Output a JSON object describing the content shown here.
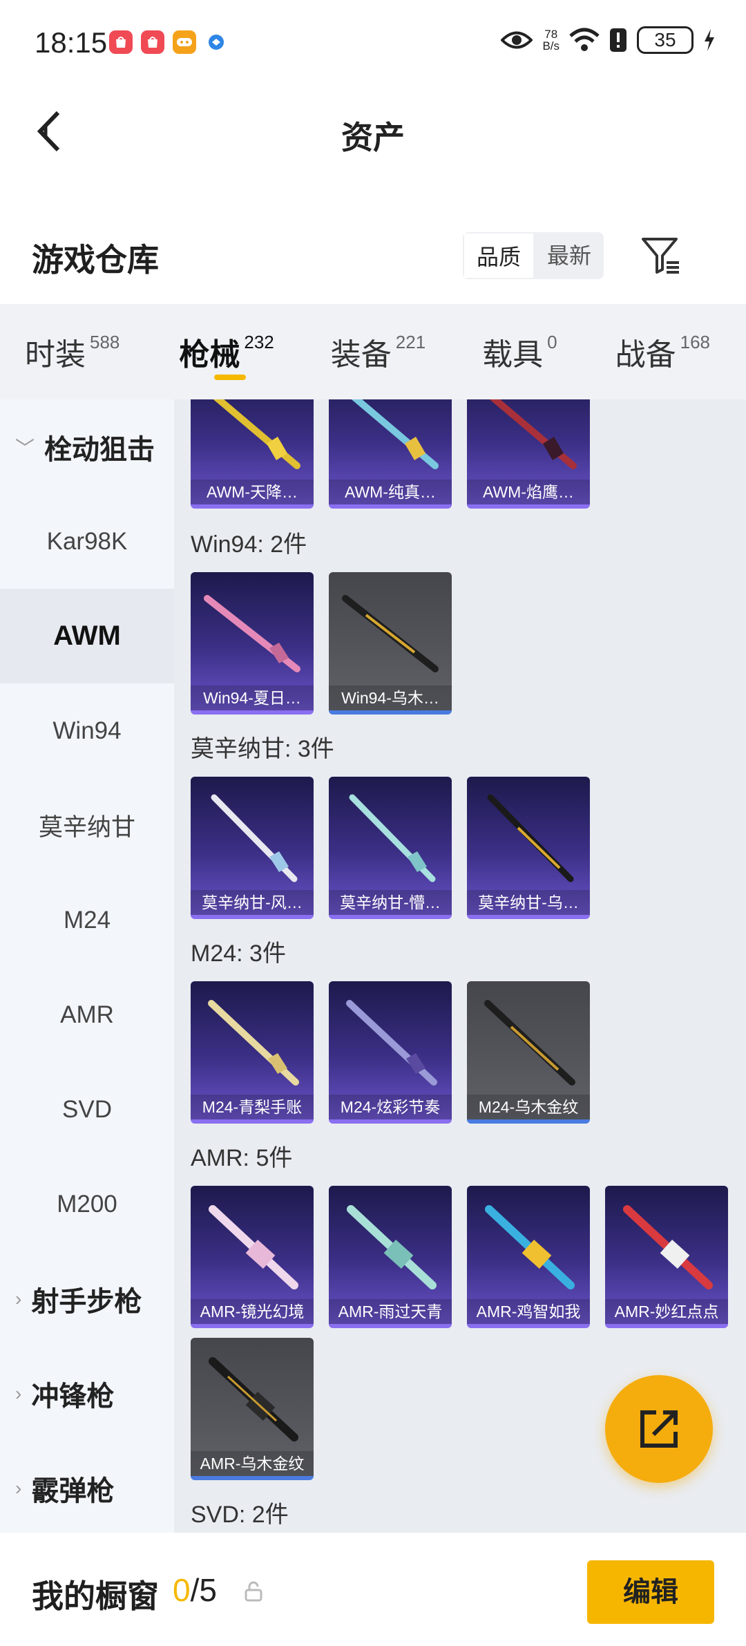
{
  "status_bar": {
    "time": "18:15",
    "net_speed_value": "78",
    "net_speed_unit": "B/s",
    "battery": "35",
    "icons": [
      "eye-icon",
      "wifi-icon",
      "alert-icon",
      "battery-icon",
      "charging-icon"
    ]
  },
  "nav": {
    "title": "资产",
    "back_icon": "chevron-left-icon"
  },
  "warehouse": {
    "title": "游戏仓库",
    "sort_options": [
      "品质",
      "最新"
    ],
    "sort_selected": "品质",
    "filter_icon": "filter-icon"
  },
  "tabs": [
    {
      "label": "时装",
      "count": "588"
    },
    {
      "label": "枪械",
      "count": "232",
      "active": true
    },
    {
      "label": "装备",
      "count": "221"
    },
    {
      "label": "载具",
      "count": "0"
    },
    {
      "label": "战备",
      "count": "168"
    }
  ],
  "sidenav": [
    {
      "label": "栓动狙击",
      "type": "group-expanded"
    },
    {
      "label": "Kar98K"
    },
    {
      "label": "AWM",
      "active": true
    },
    {
      "label": "Win94"
    },
    {
      "label": "莫辛纳甘"
    },
    {
      "label": "M24"
    },
    {
      "label": "AMR"
    },
    {
      "label": "SVD"
    },
    {
      "label": "M200"
    },
    {
      "label": "射手步枪",
      "type": "group-collapsed"
    },
    {
      "label": "冲锋枪",
      "type": "group-collapsed"
    },
    {
      "label": "霰弹枪",
      "type": "group-collapsed"
    }
  ],
  "content": {
    "awm_items": [
      "AWM-天降…",
      "AWM-纯真…",
      "AWM-焰鹰…"
    ],
    "groups": [
      {
        "label": "Win94: 2件",
        "items": [
          "Win94-夏日…",
          "Win94-乌木…"
        ]
      },
      {
        "label": "莫辛纳甘: 3件",
        "items": [
          "莫辛纳甘-风…",
          "莫辛纳甘-懵…",
          "莫辛纳甘-乌…"
        ]
      },
      {
        "label": "M24: 3件",
        "items": [
          "M24-青梨手账",
          "M24-炫彩节奏",
          "M24-乌木金纹"
        ]
      },
      {
        "label": "AMR: 5件",
        "items": [
          "AMR-镜光幻境",
          "AMR-雨过天青",
          "AMR-鸡智如我",
          "AMR-妙红点点",
          "AMR-乌木金纹"
        ]
      },
      {
        "label": "SVD: 2件",
        "items": []
      }
    ]
  },
  "fab": {
    "icon": "share-external-icon"
  },
  "bottom_bar": {
    "title": "我的橱窗",
    "current": "0",
    "sep_total": "/5",
    "lock_icon": "lock-icon",
    "edit_label": "编辑"
  },
  "colors": {
    "accent": "#f5b800",
    "card_purple": "#3b2f86",
    "card_gray": "#55565c",
    "content_bg": "#e9ecf1"
  }
}
